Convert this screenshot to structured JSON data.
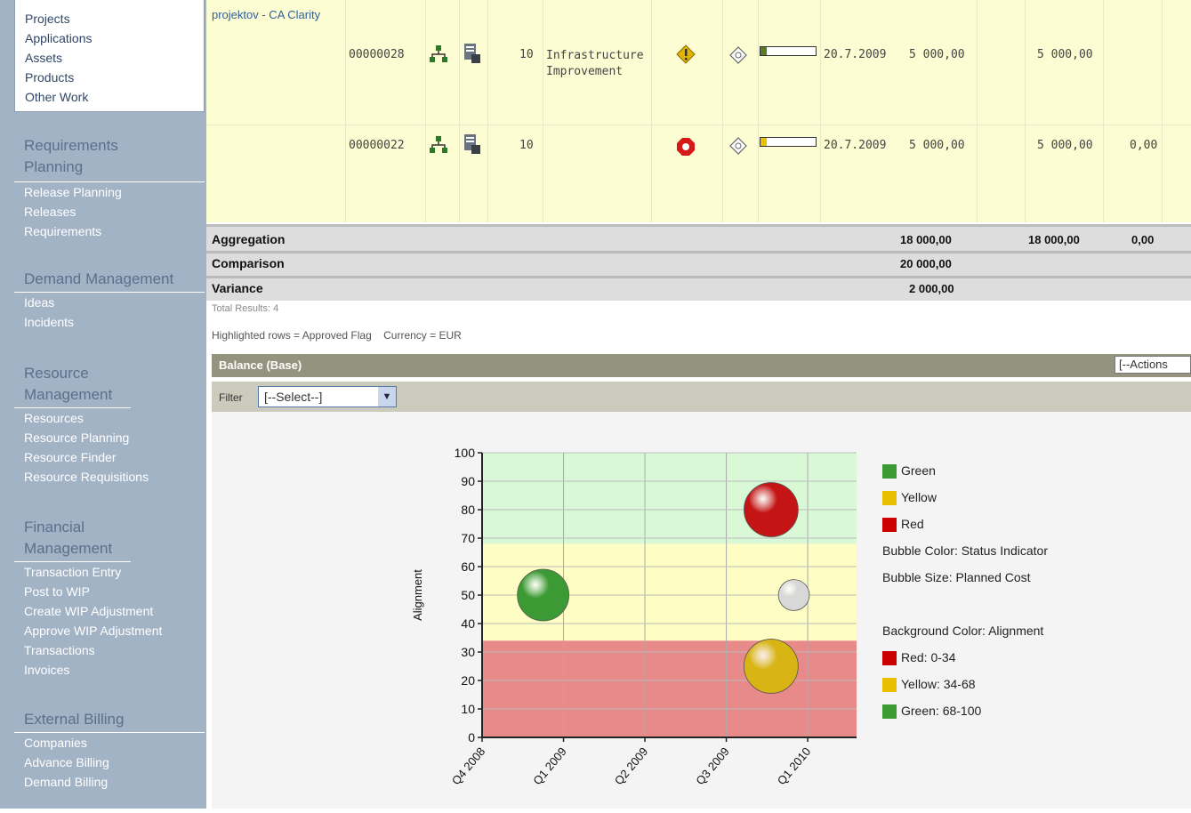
{
  "sidebar": {
    "top_items": [
      "Projects",
      "Applications",
      "Assets",
      "Products",
      "Other Work"
    ],
    "sections": [
      {
        "head": "Requirements Planning",
        "items": [
          "Release Planning",
          "Releases",
          "Requirements"
        ]
      },
      {
        "head": "Demand Management",
        "items": [
          "Ideas",
          "Incidents"
        ]
      },
      {
        "head": "Resource Management",
        "items": [
          "Resources",
          "Resource Planning",
          "Resource Finder",
          "Resource Requisitions"
        ]
      },
      {
        "head": "Financial Management",
        "items": [
          "Transaction Entry",
          "Post to WIP",
          "Create WIP Adjustment",
          "Approve WIP Adjustment",
          "Transactions",
          "Invoices"
        ]
      },
      {
        "head": "External Billing",
        "items": [
          "Companies",
          "Advance Billing",
          "Demand Billing"
        ]
      }
    ]
  },
  "table": {
    "partial_link": "projektov - CA Clarity",
    "rows": [
      {
        "id": "00000028",
        "rank": "10",
        "name": "Infrastructure Improvement",
        "date": "20.7.2009",
        "cost": "5 000,00",
        "cost2": "5 000,00",
        "extra": "",
        "status_color": "#e8c000",
        "progress": 0.12
      },
      {
        "id": "00000022",
        "rank": "10",
        "name": "",
        "date": "20.7.2009",
        "cost": "5 000,00",
        "cost2": "5 000,00",
        "extra": "0,00",
        "status_color": "#cc0000",
        "progress": 0.12
      }
    ],
    "summary": [
      {
        "label": "Aggregation",
        "v1": "18 000,00",
        "v2": "18 000,00",
        "v3": "0,00"
      },
      {
        "label": "Comparison",
        "v1": "20 000,00",
        "v2": "",
        "v3": ""
      },
      {
        "label": "Variance",
        "v1": "2 000,00",
        "v2": "",
        "v3": ""
      }
    ],
    "total_results": "Total Results: 4",
    "footnote": "Highlighted rows = Approved Flag    Currency = EUR"
  },
  "portlet": {
    "title": "Balance (Base)",
    "actions_label": "[--Actions",
    "filter_label": "Filter",
    "filter_value": "[--Select--]"
  },
  "chart_data": {
    "type": "bubble",
    "ylabel": "Alignment",
    "ylim": [
      0,
      100
    ],
    "yticks": [
      0,
      10,
      20,
      30,
      40,
      50,
      60,
      70,
      80,
      90,
      100
    ],
    "xticks": [
      "Q4 2008",
      "Q1 2009",
      "Q2 2009",
      "Q3 2009",
      "Q1 2010"
    ],
    "x_tick_positions": [
      0,
      1,
      2,
      3,
      4
    ],
    "bands": [
      {
        "from": 0,
        "to": 34,
        "color": "#e88a8a"
      },
      {
        "from": 34,
        "to": 68,
        "color": "#fdfdc4"
      },
      {
        "from": 68,
        "to": 100,
        "color": "#d9f8d5"
      }
    ],
    "points": [
      {
        "x": 0.75,
        "y": 50,
        "size": 1.0,
        "color": "#3c9a34"
      },
      {
        "x": 3.55,
        "y": 80,
        "size": 1.05,
        "color": "#c41414"
      },
      {
        "x": 3.83,
        "y": 50,
        "size": 0.6,
        "color": "#d8d8d8"
      },
      {
        "x": 3.55,
        "y": 25,
        "size": 1.05,
        "color": "#d8b414"
      }
    ],
    "legend_status": [
      {
        "label": "Green",
        "color": "#3c9a34"
      },
      {
        "label": "Yellow",
        "color": "#e8c000"
      },
      {
        "label": "Red",
        "color": "#cc0000"
      }
    ],
    "legend_text1": "Bubble Color: Status Indicator",
    "legend_text2": "Bubble Size: Planned Cost",
    "legend_text3": "Background Color: Alignment",
    "legend_bg": [
      {
        "label": "Red: 0-34",
        "color": "#cc0000"
      },
      {
        "label": "Yellow: 34-68",
        "color": "#e8c000"
      },
      {
        "label": "Green: 68-100",
        "color": "#3c9a34"
      }
    ]
  }
}
